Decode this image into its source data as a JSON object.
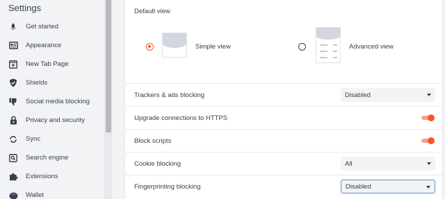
{
  "sidebar": {
    "title": "Settings",
    "items": [
      {
        "label": "Get started",
        "icon": "rocket-icon"
      },
      {
        "label": "Appearance",
        "icon": "appearance-icon"
      },
      {
        "label": "New Tab Page",
        "icon": "new-tab-icon"
      },
      {
        "label": "Shields",
        "icon": "shield-icon"
      },
      {
        "label": "Social media blocking",
        "icon": "thumbs-down-icon"
      },
      {
        "label": "Privacy and security",
        "icon": "lock-icon"
      },
      {
        "label": "Sync",
        "icon": "sync-icon"
      },
      {
        "label": "Search engine",
        "icon": "search-icon"
      },
      {
        "label": "Extensions",
        "icon": "extensions-icon"
      },
      {
        "label": "Wallet",
        "icon": "wallet-icon"
      }
    ]
  },
  "shields": {
    "default_view_label": "Default view",
    "simple_view_label": "Simple view",
    "advanced_view_label": "Advanced view",
    "selected_view": "Simple view",
    "rows": [
      {
        "label": "Trackers & ads blocking",
        "control": "select",
        "value": "Disabled"
      },
      {
        "label": "Upgrade connections to HTTPS",
        "control": "toggle",
        "value": true
      },
      {
        "label": "Block scripts",
        "control": "toggle",
        "value": true
      },
      {
        "label": "Cookie blocking",
        "control": "select",
        "value": "All"
      },
      {
        "label": "Fingerprinting blocking",
        "control": "select",
        "value": "Disabled"
      }
    ]
  },
  "colors": {
    "accent": "#fb542b",
    "sidebar_bg": "#f1f3f5",
    "panel_bg": "#ffffff",
    "text": "#3b3e4f",
    "focus_border": "#5b8fd8"
  }
}
